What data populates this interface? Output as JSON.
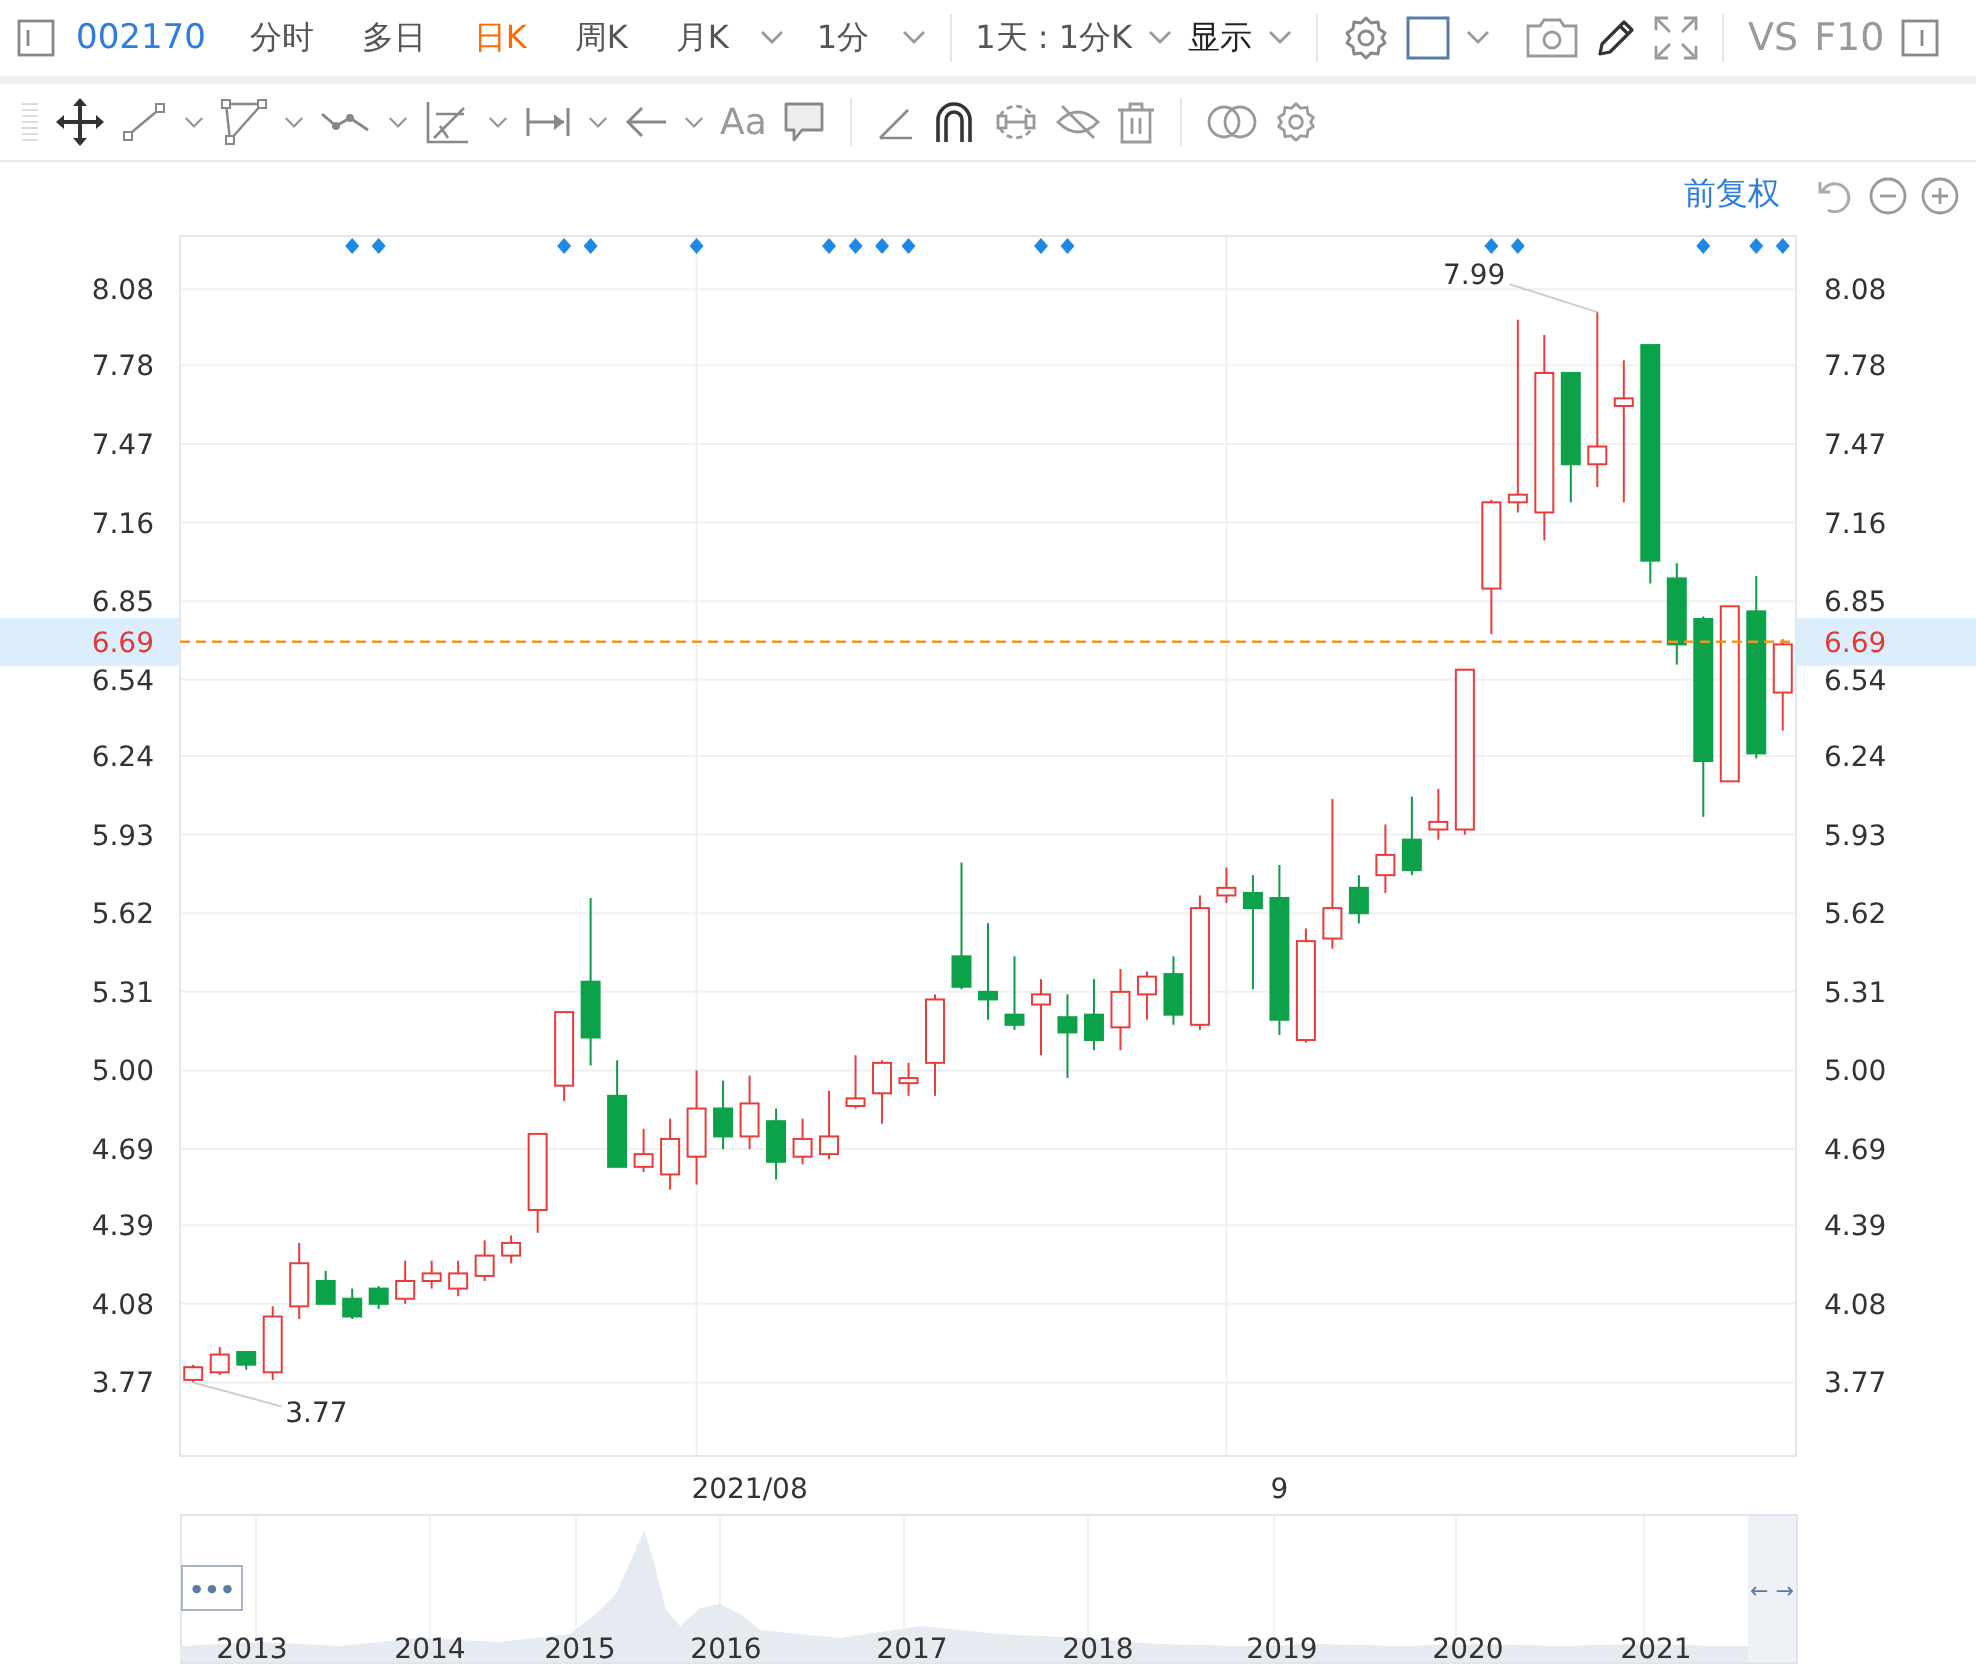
{
  "toolbar": {
    "stock_code": "002170",
    "periods": [
      {
        "label": "分时",
        "selected": false,
        "dropdown": false
      },
      {
        "label": "多日",
        "selected": false,
        "dropdown": false
      },
      {
        "label": "日K",
        "selected": true,
        "dropdown": false
      },
      {
        "label": "周K",
        "selected": false,
        "dropdown": false
      },
      {
        "label": "月K",
        "selected": false,
        "dropdown": true
      },
      {
        "label": "1分",
        "selected": false,
        "dropdown": true
      }
    ],
    "range_select": "1天 : 1分K",
    "display_select": "显示",
    "compare": "VS",
    "f10": "F10"
  },
  "drawing_tools": {
    "text_tool": "Aa"
  },
  "chart_header": {
    "adjustment_link": "前复权"
  },
  "chart": {
    "chart_data": {
      "type": "candlestick",
      "grid": true,
      "categories": [
        null,
        null,
        null,
        null,
        null,
        null,
        null,
        null,
        null,
        null,
        null,
        null,
        null,
        null,
        null,
        null,
        null,
        null,
        null,
        null,
        null,
        "2021/08",
        null,
        null,
        null,
        null,
        null,
        null,
        null,
        null,
        null,
        null,
        null,
        null,
        null,
        null,
        null,
        null,
        null,
        null,
        null,
        "9",
        null,
        null,
        null,
        null,
        null,
        null,
        null,
        null,
        null,
        null,
        null,
        null,
        null,
        null,
        null,
        null,
        null,
        null,
        null
      ],
      "ylim": [
        3.48,
        8.29
      ],
      "yticks": [
        {
          "value": 8.08,
          "label": "8.08"
        },
        {
          "value": 7.78,
          "label": "7.78"
        },
        {
          "value": 7.47,
          "label": "7.47"
        },
        {
          "value": 7.16,
          "label": "7.16"
        },
        {
          "value": 6.85,
          "label": "6.85"
        },
        {
          "value": 6.54,
          "label": "6.54"
        },
        {
          "value": 6.24,
          "label": "6.24"
        },
        {
          "value": 5.93,
          "label": "5.93"
        },
        {
          "value": 5.62,
          "label": "5.62"
        },
        {
          "value": 5.31,
          "label": "5.31"
        },
        {
          "value": 5.0,
          "label": "5.00"
        },
        {
          "value": 4.69,
          "label": "4.69"
        },
        {
          "value": 4.39,
          "label": "4.39"
        },
        {
          "value": 4.08,
          "label": "4.08"
        },
        {
          "value": 3.77,
          "label": "3.77"
        }
      ],
      "ohlc": [
        [
          3.78,
          3.84,
          3.77,
          3.83
        ],
        [
          3.81,
          3.91,
          3.8,
          3.88
        ],
        [
          3.89,
          3.89,
          3.82,
          3.84
        ],
        [
          3.81,
          4.07,
          3.78,
          4.03
        ],
        [
          4.07,
          4.32,
          4.02,
          4.24
        ],
        [
          4.17,
          4.21,
          4.08,
          4.08
        ],
        [
          4.1,
          4.14,
          4.02,
          4.03
        ],
        [
          4.14,
          4.15,
          4.06,
          4.08
        ],
        [
          4.1,
          4.25,
          4.08,
          4.17
        ],
        [
          4.17,
          4.25,
          4.14,
          4.2
        ],
        [
          4.14,
          4.25,
          4.11,
          4.2
        ],
        [
          4.19,
          4.33,
          4.17,
          4.27
        ],
        [
          4.27,
          4.35,
          4.24,
          4.32
        ],
        [
          4.45,
          4.75,
          4.36,
          4.75
        ],
        [
          4.94,
          5.23,
          4.88,
          5.23
        ],
        [
          5.35,
          5.68,
          5.02,
          5.13
        ],
        [
          4.9,
          5.04,
          4.62,
          4.62
        ],
        [
          4.62,
          4.77,
          4.6,
          4.67
        ],
        [
          4.59,
          4.81,
          4.53,
          4.73
        ],
        [
          4.66,
          5.0,
          4.55,
          4.85
        ],
        [
          4.85,
          4.96,
          4.69,
          4.74
        ],
        [
          4.74,
          4.98,
          4.69,
          4.87
        ],
        [
          4.8,
          4.85,
          4.57,
          4.64
        ],
        [
          4.66,
          4.81,
          4.63,
          4.73
        ],
        [
          4.67,
          4.92,
          4.65,
          4.74
        ],
        [
          4.86,
          5.06,
          4.85,
          4.89
        ],
        [
          4.91,
          5.04,
          4.79,
          5.03
        ],
        [
          4.95,
          5.03,
          4.9,
          4.97
        ],
        [
          5.03,
          5.3,
          4.9,
          5.28
        ],
        [
          5.45,
          5.82,
          5.32,
          5.33
        ],
        [
          5.31,
          5.58,
          5.2,
          5.28
        ],
        [
          5.22,
          5.45,
          5.16,
          5.18
        ],
        [
          5.26,
          5.36,
          5.06,
          5.3
        ],
        [
          5.21,
          5.3,
          4.97,
          5.15
        ],
        [
          5.22,
          5.36,
          5.08,
          5.12
        ],
        [
          5.17,
          5.4,
          5.08,
          5.31
        ],
        [
          5.3,
          5.39,
          5.2,
          5.37
        ],
        [
          5.38,
          5.45,
          5.18,
          5.22
        ],
        [
          5.18,
          5.69,
          5.16,
          5.64
        ],
        [
          5.69,
          5.8,
          5.66,
          5.72
        ],
        [
          5.7,
          5.77,
          5.32,
          5.64
        ],
        [
          5.68,
          5.81,
          5.14,
          5.2
        ],
        [
          5.12,
          5.56,
          5.11,
          5.51
        ],
        [
          5.52,
          6.07,
          5.48,
          5.64
        ],
        [
          5.72,
          5.77,
          5.58,
          5.62
        ],
        [
          5.77,
          5.97,
          5.7,
          5.85
        ],
        [
          5.91,
          6.08,
          5.77,
          5.79
        ],
        [
          5.95,
          6.11,
          5.91,
          5.98
        ],
        [
          5.95,
          6.58,
          5.93,
          6.58
        ],
        [
          6.9,
          7.25,
          6.72,
          7.24
        ],
        [
          7.24,
          7.96,
          7.2,
          7.27
        ],
        [
          7.2,
          7.9,
          7.09,
          7.75
        ],
        [
          7.75,
          7.75,
          7.24,
          7.39
        ],
        [
          7.39,
          7.99,
          7.3,
          7.46
        ],
        [
          7.62,
          7.8,
          7.24,
          7.65
        ],
        [
          7.86,
          7.86,
          6.92,
          7.01
        ],
        [
          6.94,
          7.0,
          6.6,
          6.68
        ],
        [
          6.78,
          6.79,
          6.0,
          6.22
        ],
        [
          6.14,
          6.83,
          6.14,
          6.83
        ],
        [
          6.81,
          6.95,
          6.23,
          6.25
        ],
        [
          6.49,
          6.7,
          6.34,
          6.68
        ]
      ],
      "ref_lines": [
        {
          "axis": "y",
          "value": 6.69,
          "label": "6.69"
        }
      ],
      "annotations": [
        "7.99",
        "3.77"
      ]
    },
    "event_markers": [
      {
        "marked": false
      },
      {
        "marked": false
      },
      {
        "marked": false
      },
      {
        "marked": false
      },
      {
        "marked": false
      },
      {
        "marked": false
      },
      {
        "marked": true
      },
      {
        "marked": true
      },
      {
        "marked": false
      },
      {
        "marked": false
      },
      {
        "marked": false
      },
      {
        "marked": false
      },
      {
        "marked": false
      },
      {
        "marked": false
      },
      {
        "marked": true
      },
      {
        "marked": true
      },
      {
        "marked": false
      },
      {
        "marked": false
      },
      {
        "marked": false
      },
      {
        "marked": true
      },
      {
        "marked": false
      },
      {
        "marked": false
      },
      {
        "marked": false
      },
      {
        "marked": false
      },
      {
        "marked": true
      },
      {
        "marked": true
      },
      {
        "marked": true
      },
      {
        "marked": true
      },
      {
        "marked": false
      },
      {
        "marked": false
      },
      {
        "marked": false
      },
      {
        "marked": false
      },
      {
        "marked": true
      },
      {
        "marked": true
      },
      {
        "marked": false
      },
      {
        "marked": false
      },
      {
        "marked": false
      },
      {
        "marked": false
      },
      {
        "marked": false
      },
      {
        "marked": false
      },
      {
        "marked": false
      },
      {
        "marked": false
      },
      {
        "marked": false
      },
      {
        "marked": false
      },
      {
        "marked": false
      },
      {
        "marked": false
      },
      {
        "marked": false
      },
      {
        "marked": false
      },
      {
        "marked": false
      },
      {
        "marked": true
      },
      {
        "marked": true
      },
      {
        "marked": false
      },
      {
        "marked": false
      },
      {
        "marked": false
      },
      {
        "marked": false
      },
      {
        "marked": false
      },
      {
        "marked": false
      },
      {
        "marked": true
      },
      {
        "marked": false
      },
      {
        "marked": true
      },
      {
        "marked": true
      }
    ],
    "right_axis_labels": [
      "8.08",
      "7.78",
      "7.47",
      "7.16",
      "6.85",
      "6.54",
      "6.24",
      "5.93",
      "5.62",
      "5.31",
      "5.00",
      "4.69",
      "4.39",
      "4.08",
      "3.77"
    ],
    "right_price_label": "6.69"
  },
  "navigator": {
    "more_button": "•••",
    "range_arrows": "← →",
    "years": [
      "2013",
      "2014",
      "2015",
      "2016",
      "2017",
      "2018",
      "2019",
      "2020",
      "2021"
    ]
  }
}
